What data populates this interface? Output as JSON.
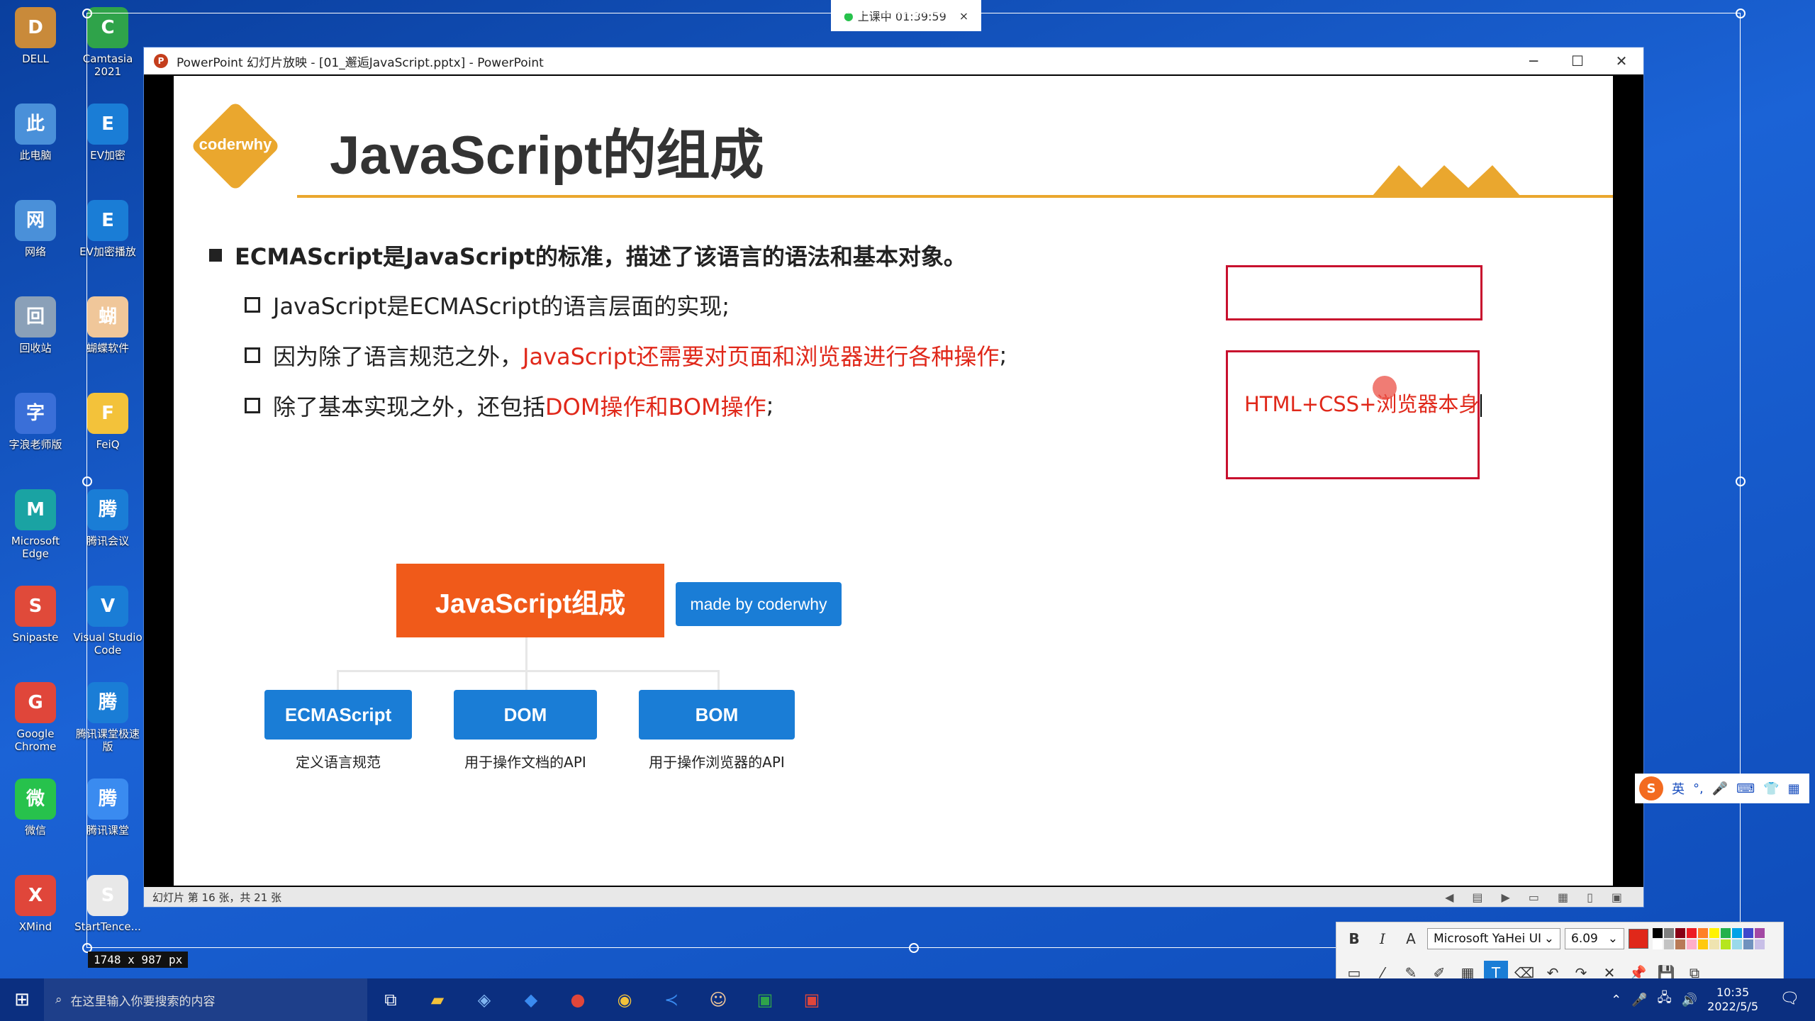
{
  "desktop": {
    "icons_col1": [
      {
        "label": "DELL",
        "icon": "folder-icon",
        "color": "#c98a3a"
      },
      {
        "label": "此电脑",
        "icon": "computer-icon",
        "color": "#4a90d9"
      },
      {
        "label": "网络",
        "icon": "network-icon",
        "color": "#4a90d9"
      },
      {
        "label": "回收站",
        "icon": "recycle-bin-icon",
        "color": "#8aa0b8"
      },
      {
        "label": "字浪老师版",
        "icon": "app-icon",
        "color": "#3a6fd8"
      },
      {
        "label": "Microsoft Edge",
        "icon": "edge-icon",
        "color": "#1aa3a3"
      },
      {
        "label": "Snipaste",
        "icon": "snipaste-icon",
        "color": "#e04a3a"
      },
      {
        "label": "Google Chrome",
        "icon": "chrome-icon",
        "color": "#e0463a"
      },
      {
        "label": "微信",
        "icon": "wechat-icon",
        "color": "#27c24c"
      },
      {
        "label": "XMind",
        "icon": "xmind-icon",
        "color": "#e0463a"
      }
    ],
    "icons_col2": [
      {
        "label": "Camtasia 2021",
        "icon": "camtasia-icon",
        "color": "#2fa34a"
      },
      {
        "label": "EV加密",
        "icon": "ev-icon",
        "color": "#1a7dd6"
      },
      {
        "label": "EV加密播放",
        "icon": "ev-player-icon",
        "color": "#1a7dd6"
      },
      {
        "label": "蝴蝶软件",
        "icon": "avatar-icon",
        "color": "#f0c79a"
      },
      {
        "label": "FeiQ",
        "icon": "feiq-icon",
        "color": "#f3c23a"
      },
      {
        "label": "腾讯会议",
        "icon": "meeting-icon",
        "color": "#1a7dd6"
      },
      {
        "label": "Visual Studio Code",
        "icon": "vscode-icon",
        "color": "#1a7dd6"
      },
      {
        "label": "腾讯课堂极速版",
        "icon": "classroom-icon",
        "color": "#1a7dd6"
      },
      {
        "label": "腾讯课堂",
        "icon": "classroom2-icon",
        "color": "#3a8bf0"
      },
      {
        "label": "StartTence...",
        "icon": "settings-icon",
        "color": "#e8e8e8"
      }
    ]
  },
  "recording_pill": "上课中 01:39:59",
  "powerpoint": {
    "title": "PowerPoint 幻灯片放映 - [01_邂逅JavaScript.pptx] - PowerPoint",
    "status": "幻灯片 第 16 张，共 21 张"
  },
  "slide": {
    "logo": "coderwhy",
    "title": "JavaScript的组成",
    "bullet_main": "ECMAScript是JavaScript的标准，描述了该语言的语法和基本对象。",
    "sub1": "JavaScript是ECMAScript的语言层面的实现;",
    "sub2_black": "因为除了语言规范之外，",
    "sub2_red": "JavaScript还需要对页面和浏览器进行各种操作",
    "sub2_end": ";",
    "sub3_black": "除了基本实现之外，还包括",
    "sub3_red": "DOM操作和BOM操作",
    "sub3_end": ";",
    "annotation": "HTML+CSS+浏览器本身",
    "diagram": {
      "root": "JavaScript组成",
      "badge": "made by coderwhy",
      "children": [
        {
          "label": "ECMAScript",
          "desc": "定义语言规范"
        },
        {
          "label": "DOM",
          "desc": "用于操作文档的API"
        },
        {
          "label": "BOM",
          "desc": "用于操作浏览器的API"
        }
      ]
    }
  },
  "selection_size": "1748 x 987  px",
  "ime": {
    "lang": "英",
    "punct": "°,"
  },
  "annot_toolbar": {
    "font": "Microsoft YaHei UI",
    "size": "6.09",
    "current_color": "#e0281a",
    "palette": [
      "#000000",
      "#7f7f7f",
      "#880015",
      "#ed1c24",
      "#ff7f27",
      "#fff200",
      "#22b14c",
      "#00a2e8",
      "#3f48cc",
      "#a349a4",
      "#ffffff",
      "#c3c3c3",
      "#b97a57",
      "#ffaec9",
      "#ffc90e",
      "#efe4b0",
      "#b5e61d",
      "#99d9ea",
      "#7092be",
      "#c8bfe7"
    ]
  },
  "taskbar": {
    "search_placeholder": "在这里输入你要搜索的内容",
    "time": "10:35",
    "date": "2022/5/5"
  }
}
